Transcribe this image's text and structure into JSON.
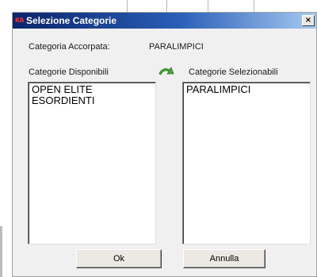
{
  "dialog": {
    "title": "Selezione Categorie",
    "app_icon_text": "KA",
    "close_glyph": "×"
  },
  "accorpata": {
    "label": "Categoria Accorpata:",
    "value": "PARALIMPICI"
  },
  "disponibili": {
    "label": "Categorie Disponibili",
    "items": [
      "OPEN ELITE",
      "ESORDIENTI"
    ]
  },
  "move_icon": "green-arrow-icon",
  "selezionabili": {
    "label": "Categorie Selezionabili",
    "items": [
      "PARALIMPICI"
    ]
  },
  "buttons": {
    "ok": "Ok",
    "annulla": "Annulla"
  }
}
